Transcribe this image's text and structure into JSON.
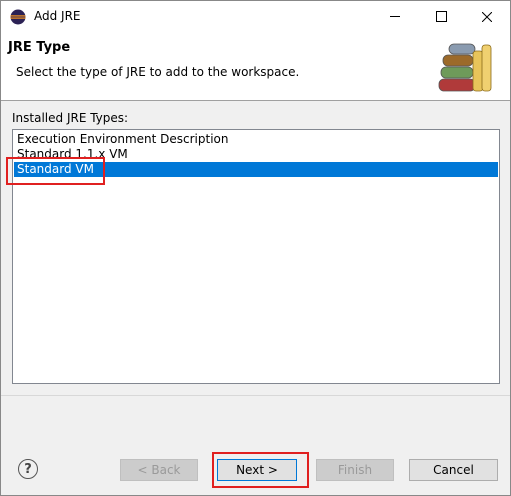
{
  "window": {
    "title": "Add JRE",
    "title_icon": "eclipse-icon",
    "controls": [
      "minimize-icon",
      "maximize-icon",
      "close-icon"
    ]
  },
  "banner": {
    "title": "JRE Type",
    "description": "Select the type of JRE to add to the workspace.",
    "icon": "books-icon"
  },
  "list": {
    "label": "Installed JRE Types:",
    "items": [
      {
        "label": "Execution Environment Description",
        "selected": false
      },
      {
        "label": "Standard 1.1.x VM",
        "selected": false
      },
      {
        "label": "Standard VM",
        "selected": true
      }
    ]
  },
  "footer": {
    "help_icon": "help-icon",
    "back_label": "< Back",
    "next_label": "Next >",
    "finish_label": "Finish",
    "cancel_label": "Cancel"
  },
  "colors": {
    "selection": "#0078d7",
    "annotation_red": "#e02020"
  }
}
